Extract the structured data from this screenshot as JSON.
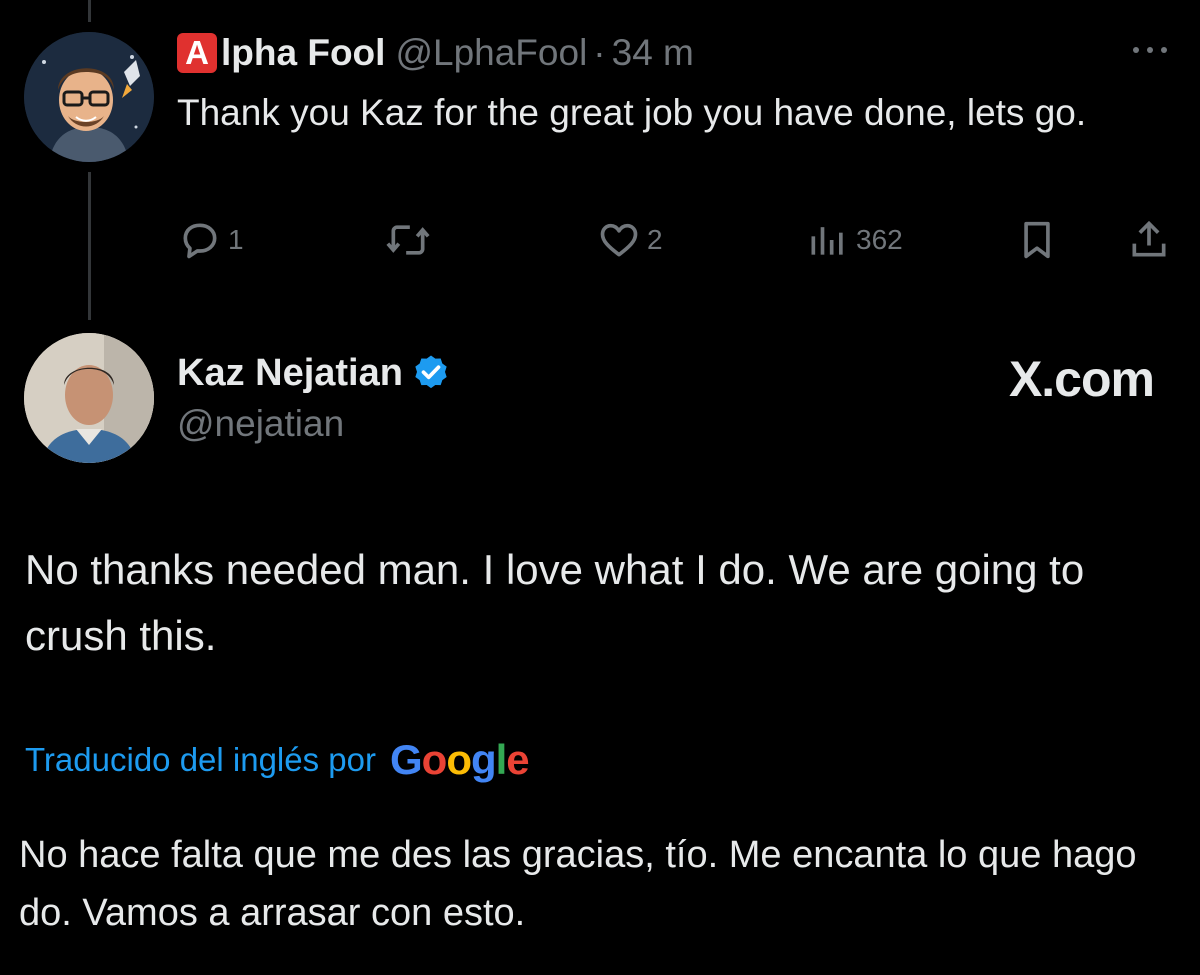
{
  "tweet1": {
    "badge_letter": "A",
    "name": "lpha Fool",
    "handle": "@LphaFool",
    "separator": "·",
    "time": "34 m",
    "text": "Thank you Kaz for the great job you have done, lets go.",
    "reply_count": "1",
    "like_count": "2",
    "view_count": "362"
  },
  "tweet2": {
    "name": "Kaz Nejatian",
    "handle": "@nejatian",
    "text": "No thanks needed man.  I love what I do.   We are going to crush this.",
    "translated_label": "Traducido del inglés por",
    "translator_brand": [
      "G",
      "o",
      "o",
      "g",
      "l",
      "e"
    ],
    "translation": "No hace falta que me des las gracias, tío. Me encanta lo que hago do. Vamos a arrasar con esto."
  },
  "watermark": "X.com",
  "colors": {
    "background": "#000000",
    "text": "#e7e9ea",
    "muted": "#71767b",
    "link": "#1d9bf0",
    "verified": "#1d9bf0",
    "badge": "#e0312f"
  }
}
